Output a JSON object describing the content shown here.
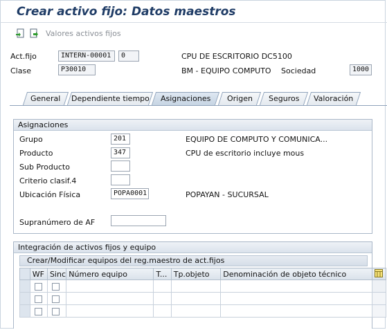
{
  "header": {
    "title": "Crear activo fijo: Datos maestros",
    "toolbar_button": "Valores activos fijos"
  },
  "asset": {
    "actfijo_label": "Act.fijo",
    "actfijo_value": "INTERN-00001",
    "subnumber": "0",
    "description": "CPU DE ESCRITORIO DC5100",
    "clase_label": "Clase",
    "clase_value": "P30010",
    "clase_desc": "BM - EQUIPO COMPUTO",
    "sociedad_label": "Sociedad",
    "sociedad_value": "1000"
  },
  "tabs": [
    {
      "label": "General"
    },
    {
      "label": "Dependiente tiempo"
    },
    {
      "label": "Asignaciones"
    },
    {
      "label": "Origen"
    },
    {
      "label": "Seguros"
    },
    {
      "label": "Valoración"
    }
  ],
  "asignaciones": {
    "title": "Asignaciones",
    "grupo_label": "Grupo",
    "grupo_value": "201",
    "grupo_desc": "EQUIPO DE COMPUTO Y COMUNICA...",
    "producto_label": "Producto",
    "producto_value": "347",
    "producto_desc": "CPU de escritorio incluye mous",
    "subproducto_label": "Sub Producto",
    "subproducto_value": "",
    "criterio_label": "Criterio clasif.4",
    "criterio_value": "",
    "ubicacion_label": "Ubicación Física",
    "ubicacion_value": "POPA0001",
    "ubicacion_desc": "POPAYAN - SUCURSAL",
    "supranumero_label": "Supranúmero de AF",
    "supranumero_value": ""
  },
  "integracion": {
    "title": "Integración de activos fijos y equipo",
    "subtitle": "Crear/Modificar equipos del reg.maestro de act.fijos",
    "columns": [
      "WF",
      "Sinc",
      "Número equipo",
      "T...",
      "Tp.objeto",
      "Denominación de objeto técnico"
    ],
    "rows": [
      {},
      {},
      {}
    ]
  },
  "colors": {
    "title": "#1f3c66",
    "tab_active": "#c6d4e3",
    "group_header": "#dbe3ec"
  }
}
